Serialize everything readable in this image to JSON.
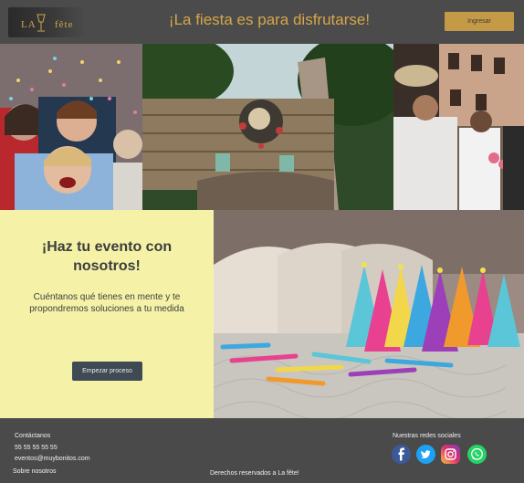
{
  "header": {
    "logo_left": "LA",
    "logo_right": "fête",
    "title": "¡La fiesta es para disfrutarse!",
    "login_label": "Ingresar"
  },
  "cta": {
    "title": "¡Haz tu evento con nosotros!",
    "text": "Cuéntanos qué tienes en mente y te propondremos soluciones a tu medida",
    "button_label": "Empezar proceso"
  },
  "footer": {
    "contact_title": "Contáctanos",
    "phone": "55 55 55 55 55",
    "email": "eventos@muybonitos.com",
    "about": "Sobre nosotros",
    "rights": "Derechos reservados a La fête!",
    "social_title": "Nuestras redes sociales"
  },
  "colors": {
    "header_bg": "#4b4b4b",
    "accent_gold": "#c59a47",
    "cta_bg": "#f5f2a8",
    "cta_button": "#3f4a54",
    "footer_bg": "#4a4a4a"
  },
  "icons": [
    "facebook-icon",
    "twitter-icon",
    "instagram-icon",
    "whatsapp-icon"
  ]
}
